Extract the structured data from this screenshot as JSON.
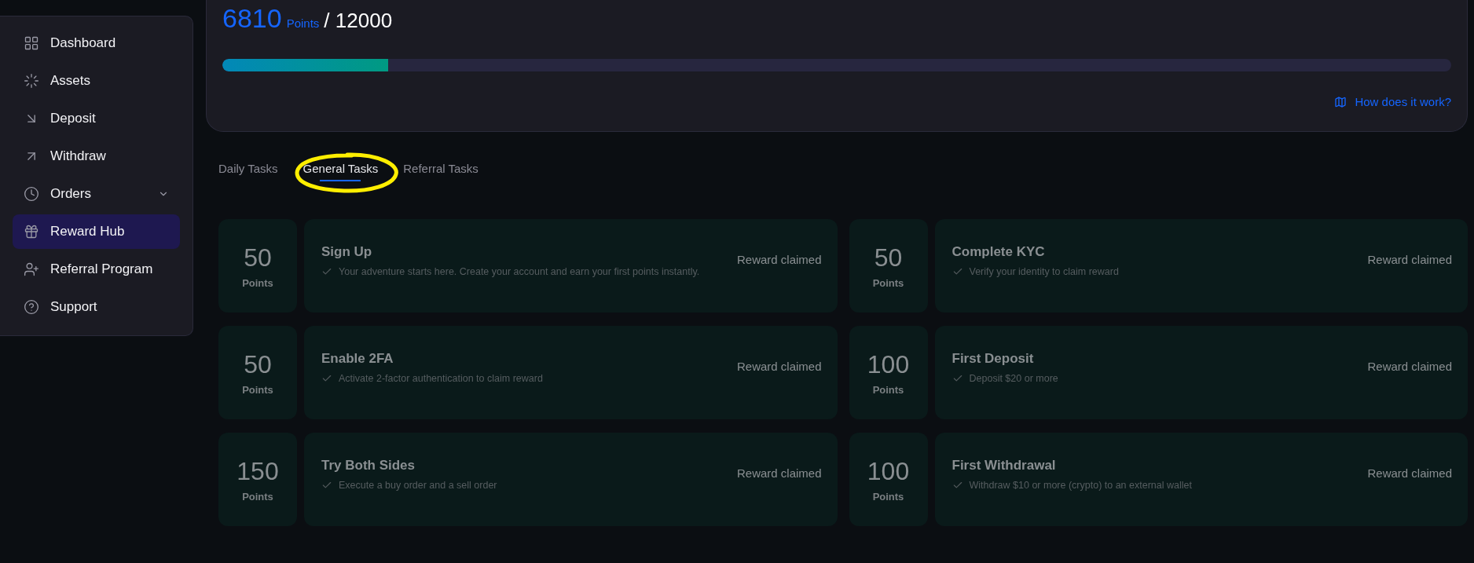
{
  "sidebar": {
    "items": [
      {
        "label": "Dashboard",
        "selected": false,
        "expandable": false
      },
      {
        "label": "Assets",
        "selected": false,
        "expandable": false
      },
      {
        "label": "Deposit",
        "selected": false,
        "expandable": false
      },
      {
        "label": "Withdraw",
        "selected": false,
        "expandable": false
      },
      {
        "label": "Orders",
        "selected": false,
        "expandable": true
      },
      {
        "label": "Reward Hub",
        "selected": true,
        "expandable": false
      },
      {
        "label": "Referral Program",
        "selected": false,
        "expandable": false
      },
      {
        "label": "Support",
        "selected": false,
        "expandable": false
      }
    ]
  },
  "progress": {
    "points": "6810",
    "unit": "Points",
    "goal": "/ 12000",
    "level": 0.135,
    "help_link": "How does it work?"
  },
  "tabs": [
    {
      "label": "Daily Tasks",
      "selected": false
    },
    {
      "label": "General Tasks",
      "selected": true
    },
    {
      "label": "Referral Tasks",
      "selected": false
    }
  ],
  "tasks": [
    {
      "points": "50",
      "unit": "Points",
      "title": "Sign Up",
      "description": "Your adventure starts here. Create your account and earn your first points instantly.",
      "status": "Reward claimed"
    },
    {
      "points": "50",
      "unit": "Points",
      "title": "Complete KYC",
      "description": "Verify your identity to claim reward",
      "status": "Reward claimed"
    },
    {
      "points": "50",
      "unit": "Points",
      "title": "Enable 2FA",
      "description": "Activate 2-factor authentication to claim reward",
      "status": "Reward claimed"
    },
    {
      "points": "100",
      "unit": "Points",
      "title": "First Deposit",
      "description": "Deposit $20 or more",
      "status": "Reward claimed"
    },
    {
      "points": "150",
      "unit": "Points",
      "title": "Try Both Sides",
      "description": "Execute a buy order and a sell order",
      "status": "Reward claimed"
    },
    {
      "points": "100",
      "unit": "Points",
      "title": "First Withdrawal",
      "description": "Withdraw $10 or more (crypto) to an external wallet",
      "status": "Reward claimed"
    }
  ]
}
